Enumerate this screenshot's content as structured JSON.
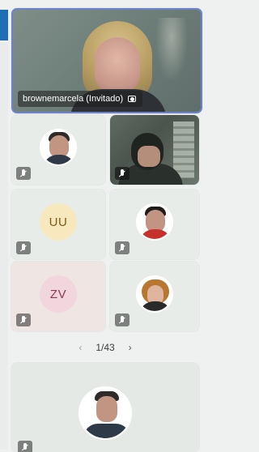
{
  "colors": {
    "accent_bar": "#1f6fb6",
    "active_border": "#6d83c9",
    "background": "#eef1ef"
  },
  "main_participant": {
    "name_label": "brownemarcela (Invitado)",
    "badge_icon": "person-frame-icon"
  },
  "participants": [
    {
      "type": "photo",
      "avatar": "avatar-man-dark-suit",
      "mic": "mic-off-icon"
    },
    {
      "type": "video",
      "mic": "mic-off-icon"
    },
    {
      "type": "initials",
      "initials": "UU",
      "mic": "mic-off-icon"
    },
    {
      "type": "photo",
      "avatar": "avatar-man-red-shirt",
      "mic": "mic-off-icon"
    },
    {
      "type": "initials",
      "initials": "ZV",
      "mic": "mic-off-icon"
    },
    {
      "type": "photo",
      "avatar": "avatar-woman",
      "mic": "mic-off-icon"
    }
  ],
  "pagination": {
    "label": "1/43",
    "prev_icon": "chevron-left-icon",
    "next_icon": "chevron-right-icon"
  },
  "bottom_participant": {
    "type": "photo",
    "avatar": "avatar-man-suit",
    "mic": "mic-off-icon"
  }
}
